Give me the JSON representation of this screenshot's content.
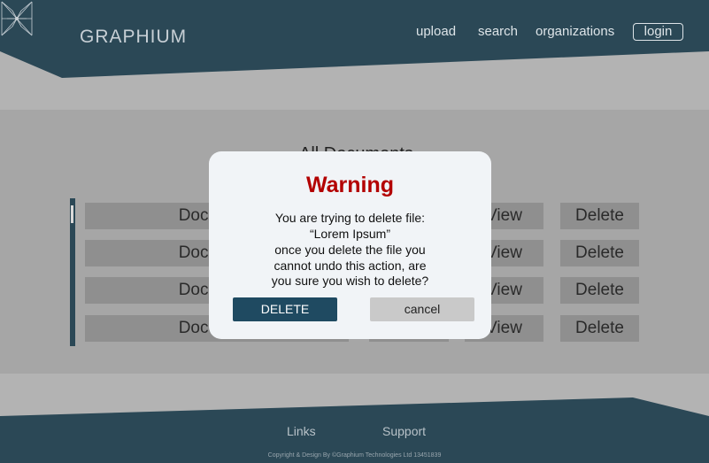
{
  "brand": {
    "name": "GRAPHIUM"
  },
  "nav": {
    "upload": "upload",
    "search": "search",
    "organizations": "organizations",
    "login": "login"
  },
  "main": {
    "title": "All Documents",
    "rows": [
      {
        "document": "Document",
        "view": "View",
        "delete": "Delete"
      },
      {
        "document": "Document",
        "view": "View",
        "delete": "Delete"
      },
      {
        "document": "Document",
        "view": "View",
        "delete": "Delete"
      },
      {
        "document": "Document",
        "view": "View",
        "delete": "Delete"
      }
    ]
  },
  "dialog": {
    "title": "Warning",
    "lines": [
      "You are trying to delete file:",
      "“Lorem Ipsum”",
      "once you delete the file you",
      "cannot undo this action, are",
      "you sure you wish to delete?"
    ],
    "confirm_label": "DELETE",
    "cancel_label": "cancel"
  },
  "footer": {
    "links": "Links",
    "support": "Support",
    "copyright": "Copyright & Design By ©Graphium Technologies Ltd 13451839"
  },
  "colors": {
    "header_bg": "#2b4856",
    "warning": "#b30000",
    "delete_button": "#1f4a61"
  }
}
